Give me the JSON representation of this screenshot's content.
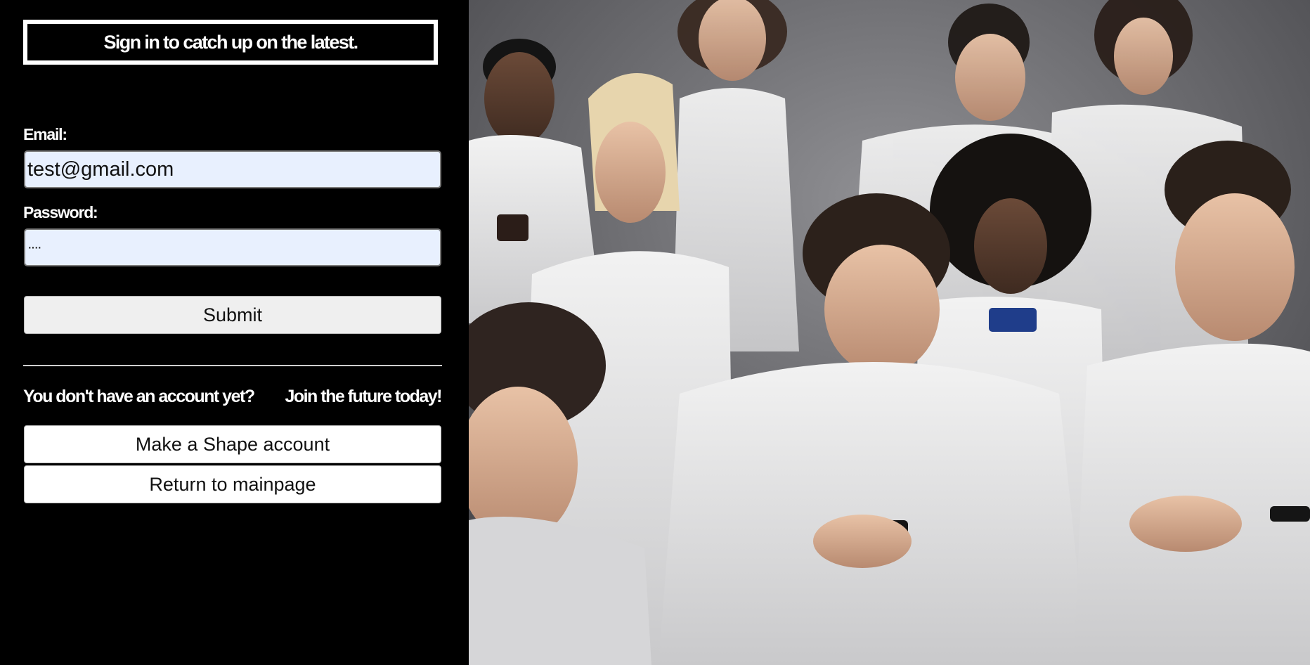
{
  "signin": {
    "title": "Sign in to catch up on the latest.",
    "email_label": "Email:",
    "email_value": "test@gmail.com",
    "password_label": "Password:",
    "password_value": "····",
    "submit_label": "Submit"
  },
  "signup": {
    "prompt_left": "You don't have an account yet?",
    "prompt_right": "Join the future today!",
    "make_account_label": "Make a Shape account",
    "return_label": "Return to mainpage"
  },
  "colors": {
    "panel_bg": "#000000",
    "input_bg": "#e8f0fe",
    "button_gray": "#efefef",
    "button_white": "#ffffff"
  }
}
